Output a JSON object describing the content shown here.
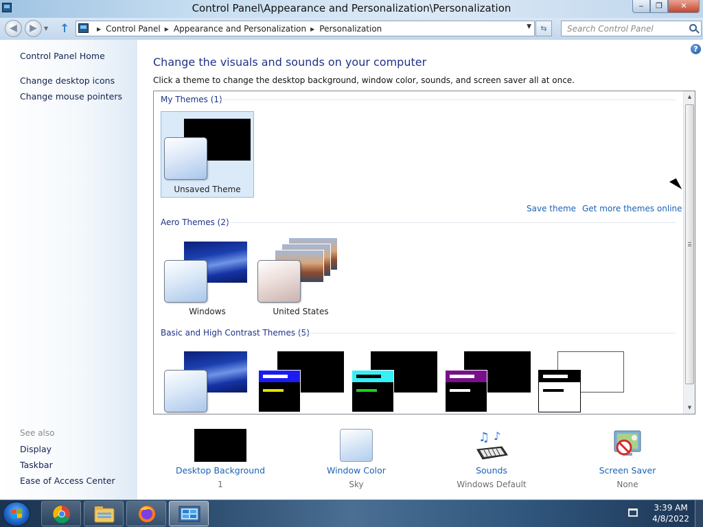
{
  "window": {
    "title": "Control Panel\\Appearance and Personalization\\Personalization",
    "minimize_glyph": "‒",
    "restore_glyph": "❐",
    "close_glyph": "✕"
  },
  "address": {
    "breadcrumbs": [
      "Control Panel",
      "Appearance and Personalization",
      "Personalization"
    ],
    "search_placeholder": "Search Control Panel"
  },
  "left_pane": {
    "links": [
      "Control Panel Home",
      "Change desktop icons",
      "Change mouse pointers"
    ],
    "see_also_title": "See also",
    "see_also": [
      "Display",
      "Taskbar",
      "Ease of Access Center"
    ]
  },
  "main": {
    "heading": "Change the visuals and sounds on your computer",
    "subheading": "Click a theme to change the desktop background, window color, sounds, and screen saver all at once.",
    "help_glyph": "?",
    "groups": {
      "my_themes": "My Themes (1)",
      "aero_themes": "Aero Themes (2)",
      "basic_themes": "Basic and High Contrast Themes (5)"
    },
    "themes": {
      "unsaved": "Unsaved Theme",
      "windows": "Windows",
      "united_states": "United States"
    },
    "save_theme": "Save theme",
    "get_more": "Get more themes online"
  },
  "options": [
    {
      "label": "Desktop Background",
      "value": "1"
    },
    {
      "label": "Window Color",
      "value": "Sky"
    },
    {
      "label": "Sounds",
      "value": "Windows Default"
    },
    {
      "label": "Screen Saver",
      "value": "None"
    }
  ],
  "taskbar": {
    "apps": [
      "chrome-icon",
      "file-explorer-icon",
      "firefox-icon",
      "control-panel-icon"
    ],
    "time": "3:39 AM",
    "date": "4/8/2022"
  },
  "colors": {
    "link": "#1a62b5",
    "heading": "#1e3287",
    "selected_tile": "#dbeaf9"
  }
}
